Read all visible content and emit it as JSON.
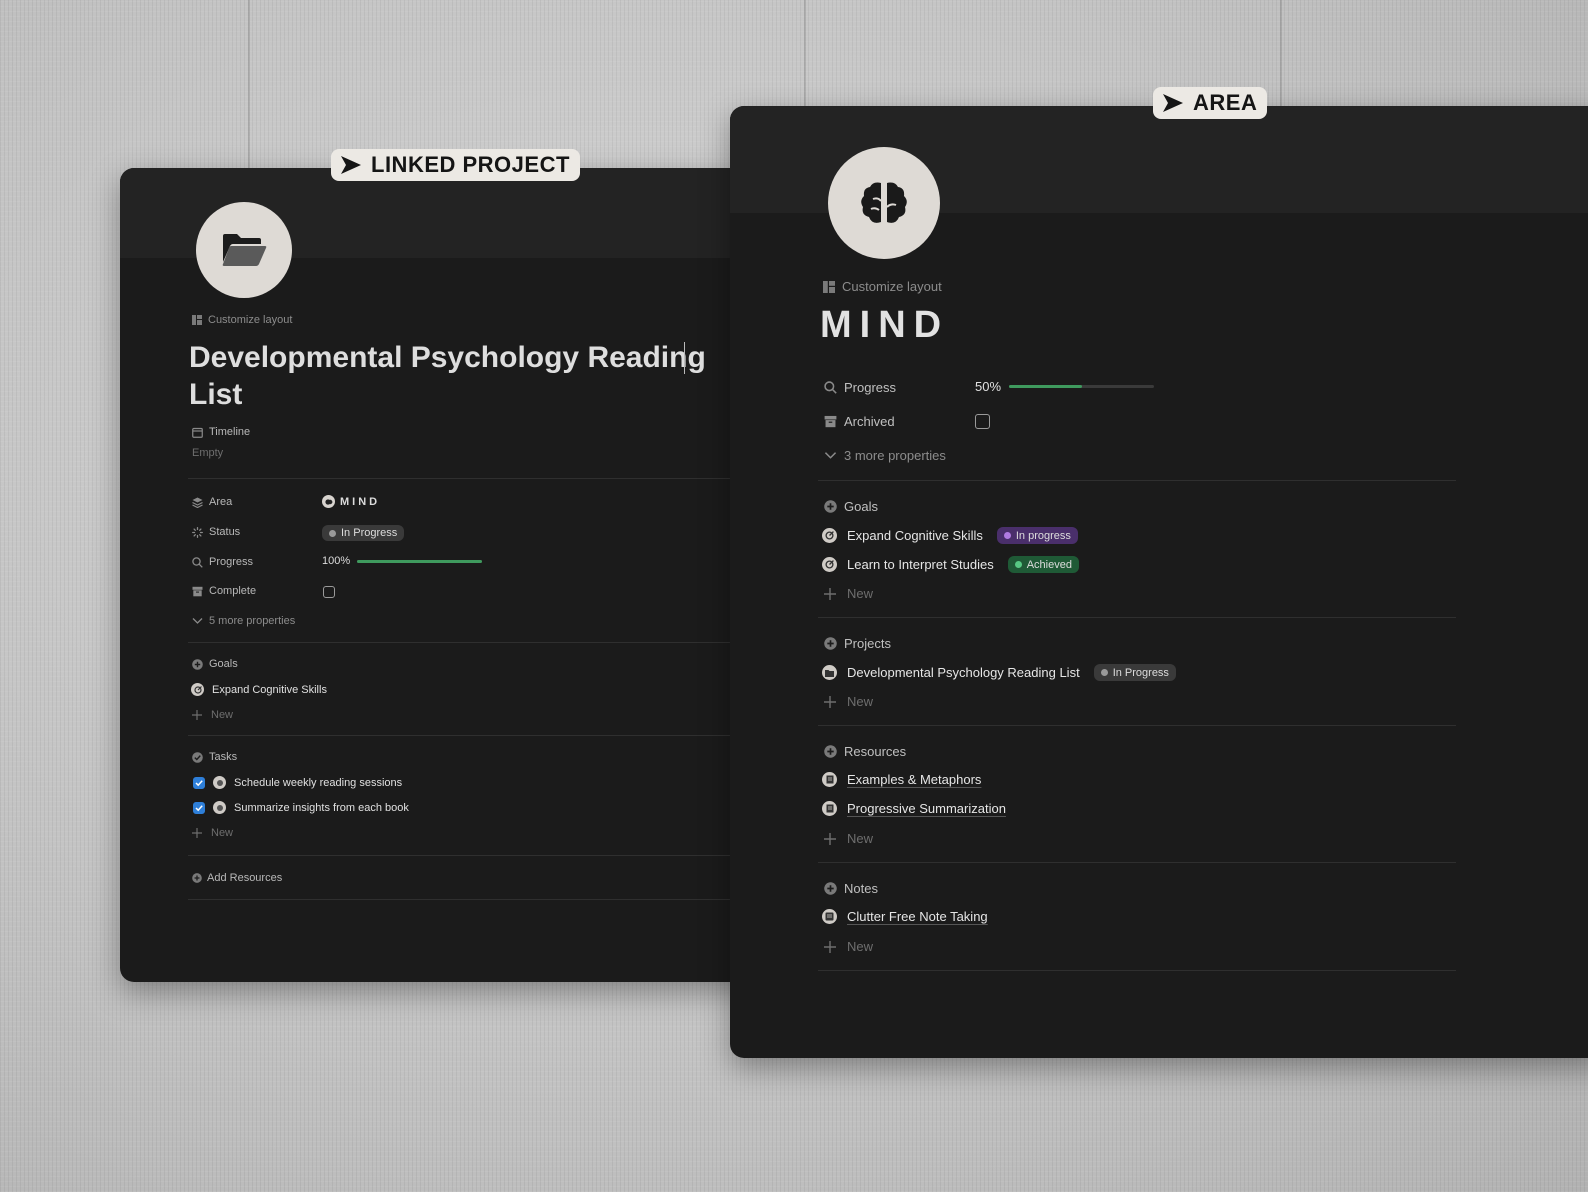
{
  "callouts": {
    "project": "LINKED PROJECT",
    "area": "AREA"
  },
  "project": {
    "customize_layout": "Customize layout",
    "title_line1": "Developmental Psychology Reading",
    "title_line2": "List",
    "timeline_label": "Timeline",
    "timeline_value": "Empty",
    "properties": {
      "area_label": "Area",
      "area_value": "MIND",
      "status_label": "Status",
      "status_value": "In Progress",
      "progress_label": "Progress",
      "progress_value": "100%",
      "progress_fraction": 1.0,
      "complete_label": "Complete",
      "more": "5 more properties"
    },
    "goals": {
      "heading": "Goals",
      "items": [
        "Expand Cognitive Skills"
      ],
      "new": "New"
    },
    "tasks": {
      "heading": "Tasks",
      "items": [
        "Schedule weekly reading sessions",
        "Summarize insights from each book"
      ],
      "new": "New"
    },
    "add_resources": "Add Resources"
  },
  "area": {
    "customize_layout": "Customize layout",
    "title": "MIND",
    "properties": {
      "progress_label": "Progress",
      "progress_value": "50%",
      "progress_fraction": 0.5,
      "archived_label": "Archived",
      "more": "3 more properties"
    },
    "goals": {
      "heading": "Goals",
      "items": [
        {
          "name": "Expand Cognitive Skills",
          "status": "In progress"
        },
        {
          "name": "Learn to Interpret Studies",
          "status": "Achieved"
        }
      ],
      "new": "New"
    },
    "projects": {
      "heading": "Projects",
      "items": [
        {
          "name": "Developmental Psychology Reading List",
          "status": "In Progress"
        }
      ],
      "new": "New"
    },
    "resources": {
      "heading": "Resources",
      "items": [
        "Examples & Metaphors",
        "Progressive Summarization"
      ],
      "new": "New"
    },
    "notes": {
      "heading": "Notes",
      "items": [
        "Clutter Free Note Taking"
      ],
      "new": "New"
    }
  },
  "colors": {
    "window_bg": "#1b1b1b",
    "banner_bg": "#232323",
    "progress_green": "#3f9a5e",
    "in_progress_purple": "#4a2f6b",
    "achieved_green": "#1f5a36",
    "in_progress_gray": "#3a3a3a",
    "checkbox_blue": "#2e7fd9"
  }
}
